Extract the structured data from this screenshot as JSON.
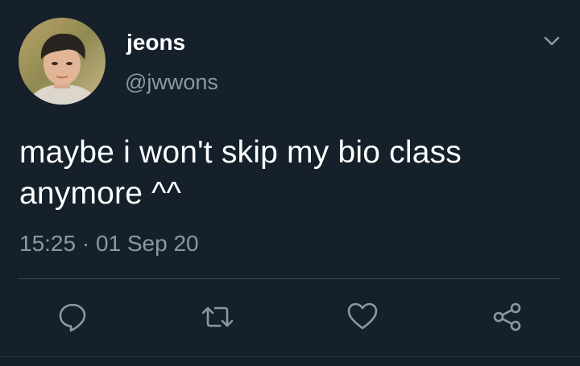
{
  "tweet": {
    "author": {
      "display_name": "jeons",
      "handle": "@jwwons",
      "avatar_icon": "profile-photo"
    },
    "text": "maybe i won't skip my bio class anymore ^^",
    "timestamp": "15:25 · 01 Sep 20"
  },
  "actions": [
    {
      "name": "reply",
      "icon": "reply-icon"
    },
    {
      "name": "retweet",
      "icon": "retweet-icon"
    },
    {
      "name": "like",
      "icon": "heart-icon"
    },
    {
      "name": "share",
      "icon": "share-icon"
    }
  ],
  "colors": {
    "background": "#15202b",
    "primary_text": "#ffffff",
    "secondary_text": "#8899a6",
    "icon": "#8899a6",
    "divider": "#38444d"
  }
}
